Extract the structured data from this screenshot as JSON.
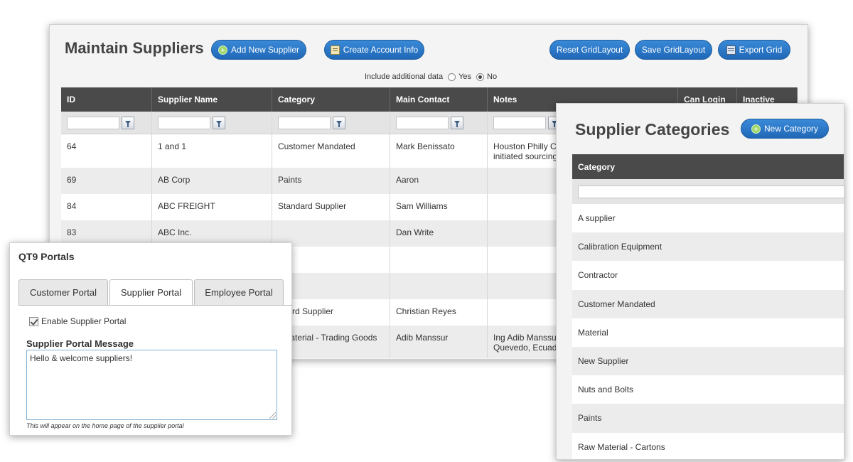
{
  "suppliers": {
    "title": "Maintain Suppliers",
    "buttons": {
      "add_new": "Add New Supplier",
      "create_account": "Create Account Info",
      "reset_grid": "Reset GridLayout",
      "save_grid": "Save GridLayout",
      "export_grid": "Export Grid"
    },
    "include_additional": {
      "label": "Include additional data",
      "options": [
        "Yes",
        "No"
      ],
      "selected": "No"
    },
    "columns": [
      "ID",
      "Supplier Name",
      "Category",
      "Main Contact",
      "Notes",
      "Can Login",
      "Inactive"
    ],
    "rows": [
      {
        "id": "64",
        "name": "1 and 1",
        "category": "Customer Mandated",
        "contact": "Mark Benissato",
        "notes": "Houston Philly Cat",
        "notes2": "initiated sourcing F"
      },
      {
        "id": "69",
        "name": "AB Corp",
        "category": "Paints",
        "contact": "Aaron",
        "notes": "",
        "notes2": ""
      },
      {
        "id": "84",
        "name": "ABC FREIGHT",
        "category": "Standard Supplier",
        "contact": "Sam Williams",
        "notes": "",
        "notes2": ""
      },
      {
        "id": "83",
        "name": "ABC Inc.",
        "category": "",
        "contact": "Dan Write",
        "notes": "",
        "notes2": ""
      },
      {
        "id": "",
        "name": "",
        "category": "",
        "contact": "",
        "notes": "",
        "notes2": ""
      },
      {
        "id": "",
        "name": "",
        "category": "",
        "contact": "",
        "notes": "",
        "notes2": ""
      },
      {
        "id": "",
        "name": "",
        "category": "ndard Supplier",
        "contact": "Christian Reyes",
        "notes": "",
        "notes2": ""
      },
      {
        "id": "",
        "name": "",
        "category": "r Material - Trading Goods",
        "contact": "Adib Manssur",
        "notes": "Ing Adib Manssur",
        "notes2": "Quevedo, Ecuador"
      }
    ]
  },
  "portals": {
    "title": "QT9 Portals",
    "tabs": [
      "Customer Portal",
      "Supplier Portal",
      "Employee Portal"
    ],
    "active_tab": "Supplier Portal",
    "enable_label": "Enable Supplier Portal",
    "enable_checked": true,
    "message_label": "Supplier Portal Message",
    "message_value": "Hello & welcome suppliers!",
    "hint": "This will appear on the home page of the supplier portal"
  },
  "categories": {
    "title": "Supplier Categories",
    "new_button": "New Category",
    "column": "Category",
    "items": [
      "A supplier",
      "Calibration Equipment",
      "Contractor",
      "Customer Mandated",
      "Material",
      "New Supplier",
      "Nuts and Bolts",
      "Paints",
      "Raw Material - Cartons"
    ]
  },
  "colors": {
    "accent": "#1f68b7",
    "header_bg": "#4a4a4a",
    "row_alt": "#ececec"
  }
}
